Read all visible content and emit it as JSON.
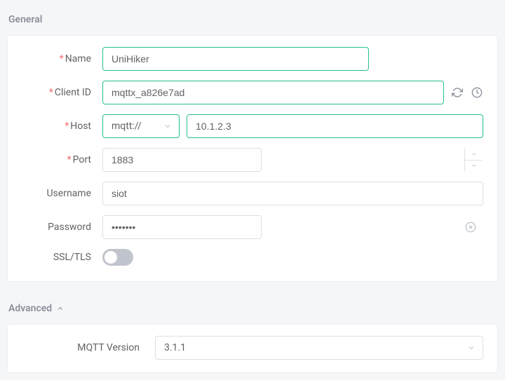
{
  "sections": {
    "general": "General",
    "advanced": "Advanced"
  },
  "labels": {
    "name": "Name",
    "clientId": "Client ID",
    "host": "Host",
    "port": "Port",
    "username": "Username",
    "password": "Password",
    "ssl": "SSL/TLS",
    "mqttVersion": "MQTT Version"
  },
  "values": {
    "name": "UniHiker",
    "clientId": "mqttx_a826e7ad",
    "scheme": "mqtt://",
    "host": "10.1.2.3",
    "port": "1883",
    "username": "siot",
    "password": "•••••••",
    "mqttVersion": "3.1.1"
  }
}
